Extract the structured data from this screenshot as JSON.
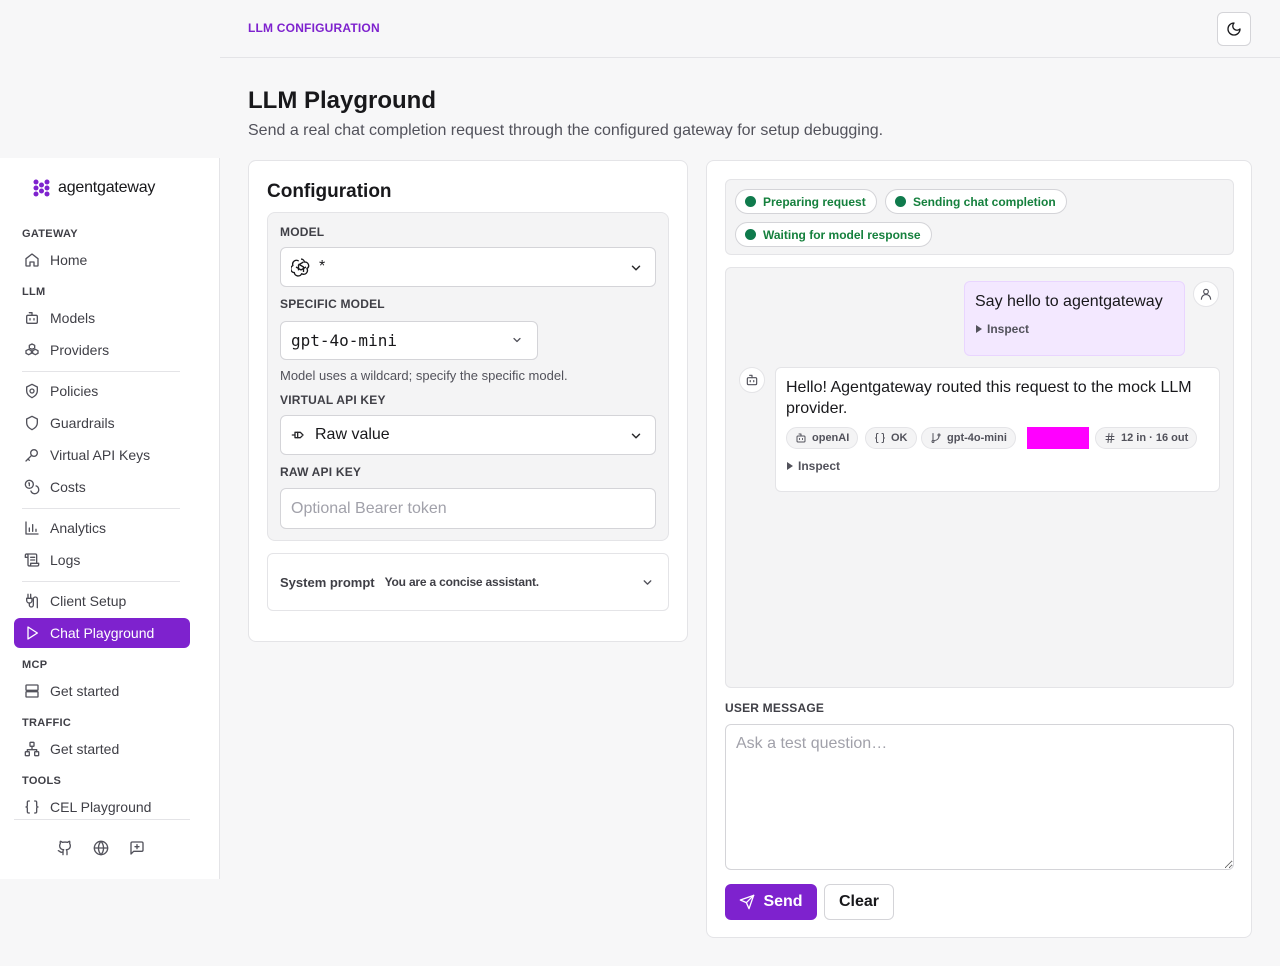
{
  "header": {
    "breadcrumb": "LLM CONFIGURATION",
    "theme_icon": "moon-icon"
  },
  "page": {
    "title": "LLM Playground",
    "subtitle": "Send a real chat completion request through the configured gateway for setup debugging."
  },
  "sidebar": {
    "brand": "agentgateway",
    "groups": {
      "gateway": "GATEWAY",
      "llm": "LLM",
      "mcp": "MCP",
      "traffic": "TRAFFIC",
      "tools": "TOOLS"
    },
    "items": {
      "home": "Home",
      "models": "Models",
      "providers": "Providers",
      "policies": "Policies",
      "guardrails": "Guardrails",
      "virtual_api_keys": "Virtual API Keys",
      "costs": "Costs",
      "analytics": "Analytics",
      "logs": "Logs",
      "client_setup": "Client Setup",
      "chat_playground": "Chat Playground",
      "mcp_get_started": "Get started",
      "traffic_get_started": "Get started",
      "cel_playground": "CEL Playground"
    },
    "footer_icons": [
      "github-icon",
      "globe-icon",
      "feedback-icon"
    ]
  },
  "config": {
    "title": "Configuration",
    "model_label": "MODEL",
    "model_value": "*",
    "specific_model_label": "SPECIFIC MODEL",
    "specific_model_value": "gpt-4o-mini",
    "hint": "Model uses a wildcard; specify the specific model.",
    "virtual_key_label": "VIRTUAL API KEY",
    "virtual_key_value": "Raw value",
    "raw_key_label": "RAW API KEY",
    "raw_key_placeholder": "Optional Bearer token",
    "system_prompt_label": "System prompt",
    "system_prompt_value": "You are a concise assistant."
  },
  "chat": {
    "statuses": [
      "Preparing request",
      "Sending chat completion",
      "Waiting for model response"
    ],
    "user_message": "Say hello to agentgateway",
    "inspect_label": "Inspect",
    "bot_message": "Hello! Agentgateway routed this request to the mock LLM provider.",
    "chips": {
      "provider": "openAI",
      "status": "OK",
      "model": "gpt-4o-mini",
      "tokens": "12 in · 16 out"
    },
    "user_message_label": "USER MESSAGE",
    "input_placeholder": "Ask a test question…",
    "send_label": "Send",
    "clear_label": "Clear"
  },
  "colors": {
    "accent": "#7e22ce",
    "status_green": "#0f7a4c",
    "redaction": "#ff00ff"
  }
}
